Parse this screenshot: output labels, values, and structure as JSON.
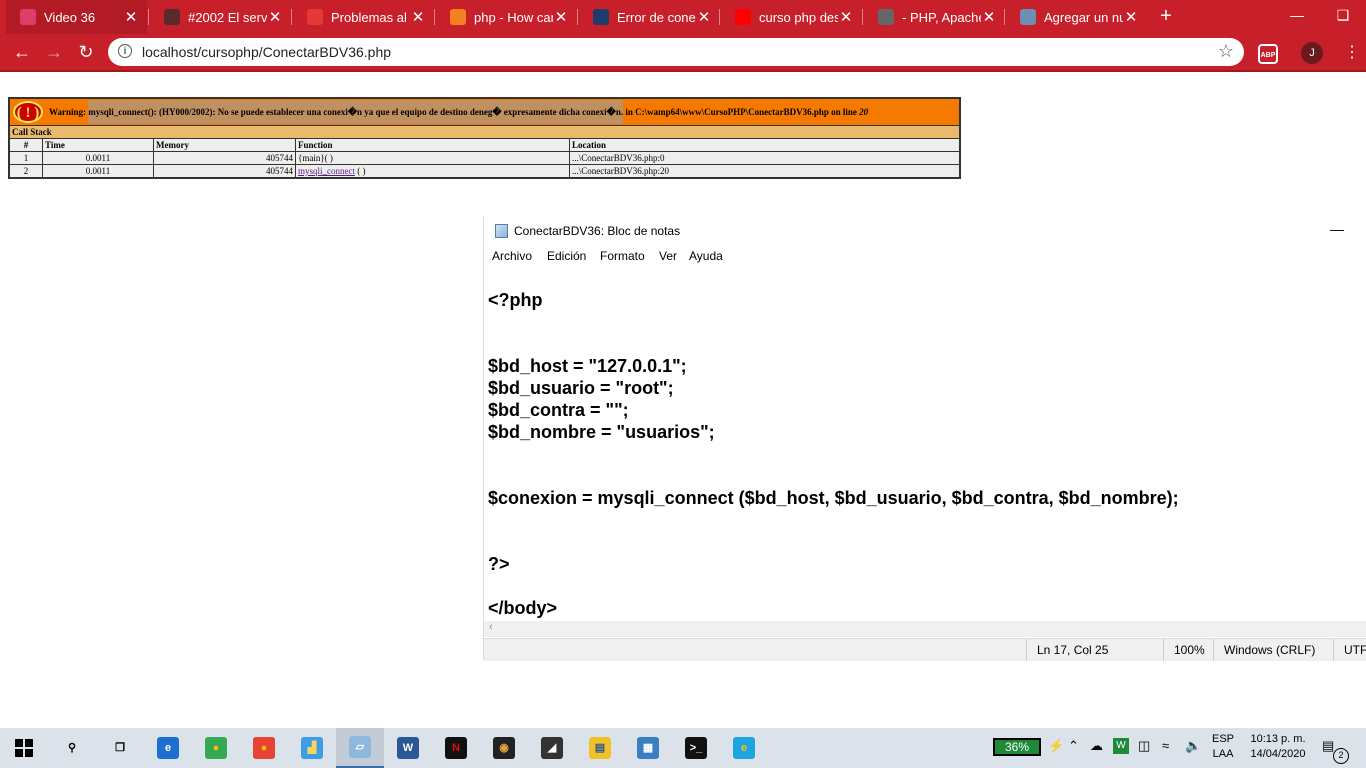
{
  "browser": {
    "tabs": [
      {
        "title": "Video 36",
        "icon": "video-app-icon",
        "color": "#e03c6a",
        "active": true
      },
      {
        "title": "#2002 El servic",
        "icon": "disc-icon",
        "color": "#5a2a2a"
      },
      {
        "title": "Problemas al t",
        "icon": "letter-p-icon",
        "color": "#e53935"
      },
      {
        "title": "php - How can",
        "icon": "stackoverflow-icon",
        "color": "#f48024"
      },
      {
        "title": "Error de conex",
        "icon": "php-icon",
        "color": "#1e3a6e"
      },
      {
        "title": "curso php desc",
        "icon": "youtube-icon",
        "color": "#ff0000"
      },
      {
        "title": "- PHP, Apache",
        "icon": "globe-icon",
        "color": "#666666"
      },
      {
        "title": "Agregar un nu",
        "icon": "document-icon",
        "color": "#6d8fb5"
      }
    ],
    "new_tab_label": "+",
    "url": "localhost/cursophp/ConectarBDV36.php",
    "abp_label": "ABP",
    "profile_initial": "J"
  },
  "php_error": {
    "warning_label": "Warning",
    "message": "mysqli_connect(): (HY000/2002): No se puede establecer una conexi�n ya que el equipo de destino deneg� expresamente dicha conexi�n.",
    "location_text": "in C:\\wamp64\\www\\CursoPHP\\ConectarBDV36.php on line",
    "line": "20",
    "call_stack_title": "Call Stack",
    "columns": [
      "#",
      "Time",
      "Memory",
      "Function",
      "Location"
    ],
    "rows": [
      {
        "num": "1",
        "time": "0.0011",
        "memory": "405744",
        "function": "{main}( )",
        "function_link": "",
        "location": "...\\ConectarBDV36.php:0"
      },
      {
        "num": "2",
        "time": "0.0011",
        "memory": "405744",
        "function": "( )",
        "function_link": "mysqli_connect",
        "location": "...\\ConectarBDV36.php:20"
      }
    ]
  },
  "notepad": {
    "title": "ConectarBDV36: Bloc de notas",
    "menu": [
      "Archivo",
      "Edición",
      "Formato",
      "Ver",
      "Ayuda"
    ],
    "content": "<?php\n\n\n$bd_host = \"127.0.0.1\";\n$bd_usuario = \"root\";\n$bd_contra = \"\";\n$bd_nombre = \"usuarios\";\n\n\n$conexion = mysqli_connect ($bd_host, $bd_usuario, $bd_contra, $bd_nombre);\n\n\n?>\n\n</body>",
    "status": {
      "position": "Ln 17, Col 25",
      "zoom": "100%",
      "line_endings": "Windows (CRLF)",
      "encoding": "UTF-"
    }
  },
  "taskbar": {
    "apps": [
      {
        "name": "search-icon",
        "glyph": "⚲",
        "color": "#dbe2ea",
        "fg": "#000000"
      },
      {
        "name": "task-view-icon",
        "glyph": "❐",
        "color": "#dbe2ea",
        "fg": "#000000"
      },
      {
        "name": "edge-icon",
        "glyph": "e",
        "color": "#1e6fd0",
        "fg": "#ffffff"
      },
      {
        "name": "chrome-icon",
        "glyph": "●",
        "color": "#34a853",
        "fg": "#fbbc05"
      },
      {
        "name": "chrome-profile-icon",
        "glyph": "●",
        "color": "#ea4335",
        "fg": "#fbbc05"
      },
      {
        "name": "file-explorer-folder-icon",
        "glyph": "▟",
        "color": "#3b9ee8",
        "fg": "#ffd35c"
      },
      {
        "name": "notepad-icon",
        "glyph": "▱",
        "color": "#8fb8de",
        "fg": "#ffffff"
      },
      {
        "name": "word-icon",
        "glyph": "W",
        "color": "#2b5797",
        "fg": "#ffffff"
      },
      {
        "name": "netflix-icon",
        "glyph": "N",
        "color": "#111111",
        "fg": "#e50914"
      },
      {
        "name": "groove-music-icon",
        "glyph": "◉",
        "color": "#222222",
        "fg": "#e8a33c"
      },
      {
        "name": "sticky-tool-icon",
        "glyph": "◢",
        "color": "#333333",
        "fg": "#ffffff"
      },
      {
        "name": "explorer-icon",
        "glyph": "▤",
        "color": "#f2c028",
        "fg": "#2b5797"
      },
      {
        "name": "control-panel-icon",
        "glyph": "▦",
        "color": "#3a7fc1",
        "fg": "#ffffff"
      },
      {
        "name": "terminal-icon",
        "glyph": ">_",
        "color": "#111111",
        "fg": "#ffffff"
      },
      {
        "name": "internet-explorer-icon",
        "glyph": "e",
        "color": "#1ea4e0",
        "fg": "#f5c518"
      }
    ],
    "battery": "36%",
    "lang_top": "ESP",
    "lang_bottom": "LAA",
    "time": "10:13 p. m.",
    "date": "14/04/2020",
    "notifications": "2"
  }
}
